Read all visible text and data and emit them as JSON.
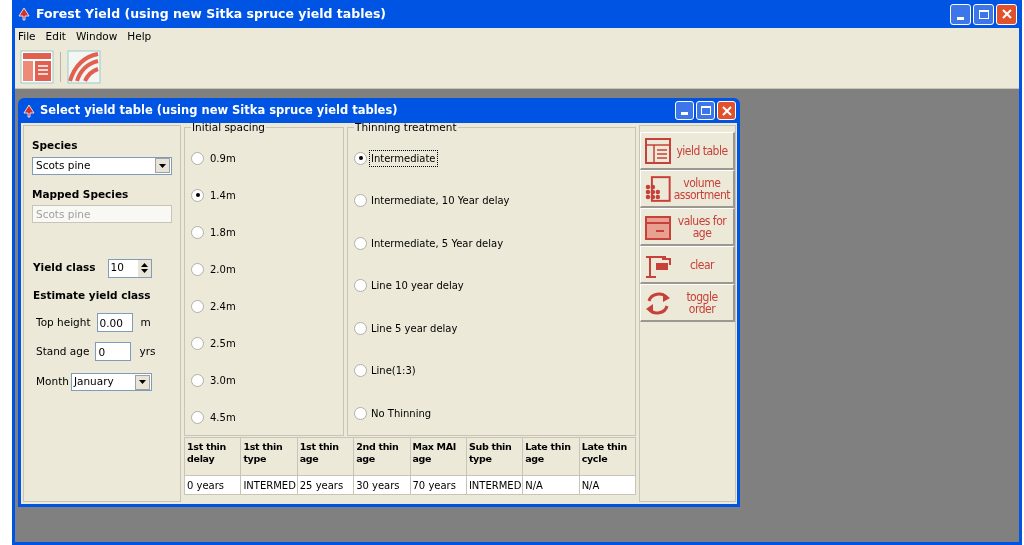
{
  "window": {
    "title": "Forest Yield (using new Sitka spruce yield tables)"
  },
  "menu": [
    "File",
    "Edit",
    "Window",
    "Help"
  ],
  "toolbar": [
    {
      "kind": "table"
    },
    {
      "kind": "curves"
    }
  ],
  "dialog": {
    "title": "Select yield table (using new Sitka spruce yield tables)",
    "species": {
      "label": "Species",
      "value": "Scots pine"
    },
    "mapped_species": {
      "label": "Mapped Species",
      "value": "Scots pine",
      "disabled": true
    },
    "yield_class": {
      "label": "Yield class",
      "value": "10"
    },
    "estimate": {
      "title": "Estimate yield class",
      "fields": [
        {
          "label": "Top height",
          "value": "0.00",
          "unit": "m"
        },
        {
          "label": "Stand age",
          "value": "0",
          "unit": "yrs"
        }
      ],
      "month": {
        "label": "Month",
        "value": "January"
      }
    },
    "spacing": {
      "title": "Initial spacing",
      "options": [
        {
          "label": "0.9m",
          "selected": false
        },
        {
          "label": "1.4m",
          "selected": true
        },
        {
          "label": "1.8m",
          "selected": false
        },
        {
          "label": "2.0m",
          "selected": false
        },
        {
          "label": "2.4m",
          "selected": false
        },
        {
          "label": "2.5m",
          "selected": false
        },
        {
          "label": "3.0m",
          "selected": false
        },
        {
          "label": "4.5m",
          "selected": false
        }
      ]
    },
    "thinning": {
      "title": "Thinning treatment",
      "options": [
        {
          "label": "Intermediate",
          "selected": true
        },
        {
          "label": "Intermediate, 10 Year delay",
          "selected": false
        },
        {
          "label": "Intermediate, 5 Year delay",
          "selected": false
        },
        {
          "label": "Line 10 year delay",
          "selected": false
        },
        {
          "label": "Line 5 year delay",
          "selected": false
        },
        {
          "label": "Line(1:3)",
          "selected": false
        },
        {
          "label": "No Thinning",
          "selected": false
        }
      ]
    },
    "actions": [
      {
        "kind": "table",
        "label": "yield table"
      },
      {
        "kind": "volume",
        "label": "volume assortment"
      },
      {
        "kind": "age",
        "label": "values for age"
      },
      {
        "kind": "clear",
        "label": "clear"
      },
      {
        "kind": "toggle",
        "label": "toggle order"
      }
    ],
    "table": {
      "columns": [
        "1st thin delay",
        "1st thin type",
        "1st thin age",
        "2nd thin age",
        "Max MAI age",
        "Sub thin type",
        "Late thin age",
        "Late thin cycle"
      ],
      "rows": [
        [
          "0 years",
          "INTERMED",
          "25 years",
          "30 years",
          "70 years",
          "INTERMED",
          "N/A",
          "N/A"
        ]
      ]
    }
  }
}
